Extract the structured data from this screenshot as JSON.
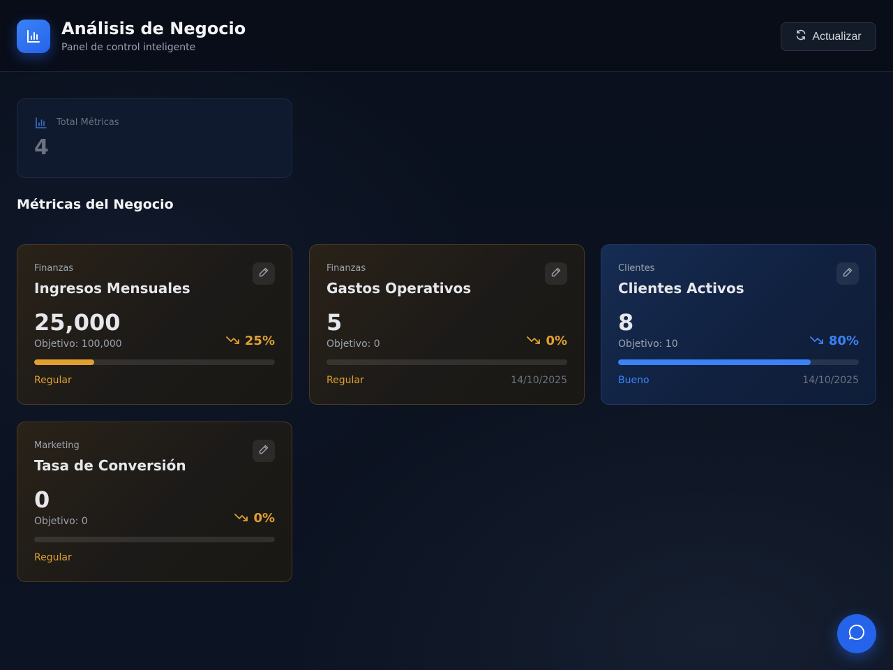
{
  "header": {
    "title": "Análisis de Negocio",
    "subtitle": "Panel de control inteligente",
    "logo_icon": "bar-chart-icon",
    "refresh_label": "Actualizar",
    "refresh_icon": "refresh-icon"
  },
  "summary": {
    "label": "Total Métricas",
    "value": "4",
    "icon": "bar-chart-icon"
  },
  "section_title": "Métricas del Negocio",
  "colors": {
    "accent": "#2563eb",
    "warning": "#e0a030",
    "good": "#3b82f6"
  },
  "metrics": [
    {
      "category": "Finanzas",
      "name": "Ingresos Mensuales",
      "value": "25,000",
      "target": "Objetivo: 100,000",
      "percent": "25%",
      "progress": 0.25,
      "status": "Regular",
      "date": "",
      "tone": "warn"
    },
    {
      "category": "Finanzas",
      "name": "Gastos Operativos",
      "value": "5",
      "target": "Objetivo: 0",
      "percent": "0%",
      "progress": 0,
      "status": "Regular",
      "date": "14/10/2025",
      "tone": "warn"
    },
    {
      "category": "Clientes",
      "name": "Clientes Activos",
      "value": "8",
      "target": "Objetivo: 10",
      "percent": "80%",
      "progress": 0.8,
      "status": "Bueno",
      "date": "14/10/2025",
      "tone": "good"
    },
    {
      "category": "Marketing",
      "name": "Tasa de Conversión",
      "value": "0",
      "target": "Objetivo: 0",
      "percent": "0%",
      "progress": 0,
      "status": "Regular",
      "date": "",
      "tone": "warn"
    }
  ],
  "fab_icon": "chat-icon"
}
